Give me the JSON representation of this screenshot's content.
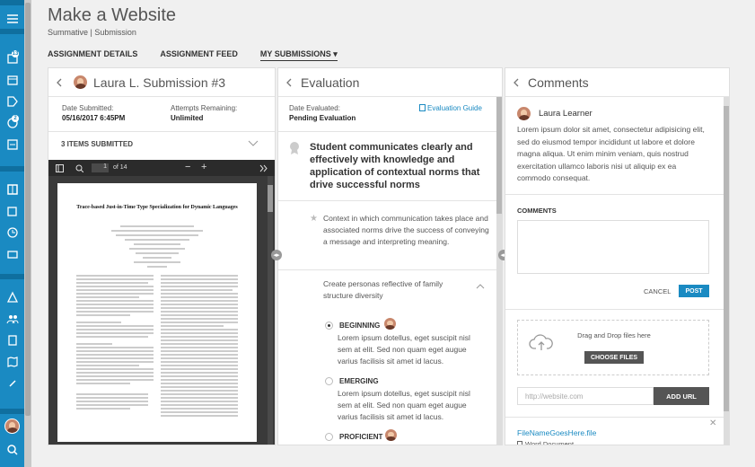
{
  "page": {
    "title": "Make a Website",
    "subtitle": "Summative | Submission"
  },
  "tabs": [
    {
      "label": "ASSIGNMENT DETAILS"
    },
    {
      "label": "ASSIGNMENT FEED"
    },
    {
      "label": "MY SUBMISSIONS",
      "caret": "▾"
    }
  ],
  "nav": {
    "badges": [
      "13",
      "2"
    ],
    "icons": [
      "courses-icon",
      "calendar-icon",
      "tag-icon",
      "chat-icon",
      "grades-icon",
      "book-icon",
      "layers-icon",
      "history-icon",
      "wallet-icon",
      "warning-icon",
      "people-icon",
      "building-icon",
      "map-icon",
      "link-icon",
      "search-icon"
    ]
  },
  "submission": {
    "title": "Laura L. Submission #3",
    "date_label": "Date Submitted:",
    "date_value": "05/16/2017 6:45PM",
    "attempts_label": "Attempts Remaining:",
    "attempts_value": "Unlimited",
    "items_label": "3 ITEMS SUBMITTED",
    "viewer": {
      "page": "1",
      "of": "of 14",
      "minus": "−",
      "plus": "+"
    },
    "doc": {
      "title": "Trace-based Just-in-Time Type Specialization for Dynamic Languages"
    }
  },
  "evaluation": {
    "title": "Evaluation",
    "evaluated_label": "Date Evaluated:",
    "evaluated_value": "Pending Evaluation",
    "guide": "Evaluation Guide",
    "outcome": "Student communicates clearly and effectively with knowledge and application of contextual norms that drive successful norms",
    "criterion": "Context in which communication takes place and associated norms drive the success of conveying a message and interpreting meaning.",
    "subcriterion": "Create personas reflective of family structure diversity",
    "levels": [
      {
        "name": "BEGINNING",
        "selected": true,
        "text": "Lorem ipsum dotellus, eget suscipit nisl sem at elit. Sed non quam eget augue varius facilisis sit amet id lacus."
      },
      {
        "name": "EMERGING",
        "selected": false,
        "text": "Lorem ipsum dotellus, eget suscipit nisl sem at elit. Sed non quam eget augue varius facilisis sit amet id lacus."
      },
      {
        "name": "PROFICIENT",
        "selected": false,
        "text": ""
      }
    ]
  },
  "comments": {
    "title": "Comments",
    "author": "Laura Learner",
    "text": "Lorem ipsum dolor sit amet, consectetur adipisicing elit, sed do eiusmod tempor incididunt ut labore et dolore magna aliqua. Ut enim minim veniam, quis nostrud exercitation ullamco laboris nisi ut aliquip ex ea commodo consequat.",
    "section_label": "COMMENTS",
    "cancel": "CANCEL",
    "post": "POST",
    "drop_text": "Drag and Drop files here",
    "choose": "CHOOSE FILES",
    "url_placeholder": "http://website.com",
    "add_url": "ADD URL",
    "file_name": "FileNameGoesHere.file",
    "file_type": "Word Document",
    "close": "✕"
  },
  "colors": {
    "nav": "#1a8ac2",
    "accent": "#1a8ac2",
    "button_dark": "#555555"
  }
}
